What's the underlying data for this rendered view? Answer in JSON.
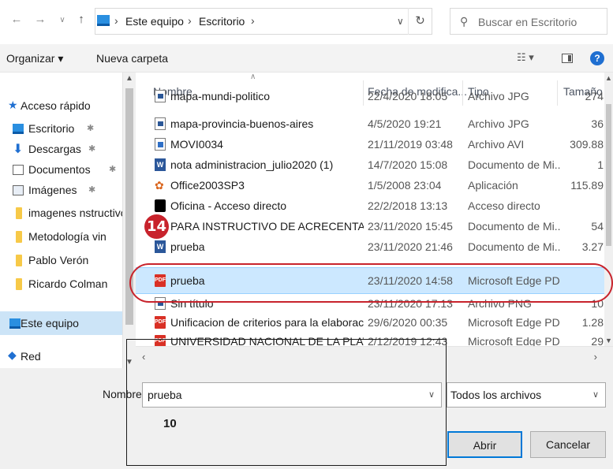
{
  "address": {
    "crumbs": [
      "Este equipo",
      "Escritorio"
    ],
    "search_placeholder": "Buscar en Escritorio"
  },
  "toolbar": {
    "organize": "Organizar ▾",
    "new_folder": "Nueva carpeta"
  },
  "sidebar": {
    "items": [
      {
        "label": "Acceso rápido",
        "icon": "star-icon",
        "pinned": false
      },
      {
        "label": "Escritorio",
        "icon": "desktop-icon",
        "pinned": true
      },
      {
        "label": "Descargas",
        "icon": "download-icon",
        "pinned": true
      },
      {
        "label": "Documentos",
        "icon": "documents-icon",
        "pinned": true
      },
      {
        "label": "Imágenes",
        "icon": "images-icon",
        "pinned": true
      },
      {
        "label": "imagenes nstructivo",
        "icon": "folder-icon",
        "pinned": false
      },
      {
        "label": "Metodología vin",
        "icon": "folder-icon",
        "pinned": false
      },
      {
        "label": "Pablo Verón",
        "icon": "folder-icon",
        "pinned": false
      },
      {
        "label": "Ricardo Colman",
        "icon": "folder-icon",
        "pinned": false
      },
      {
        "label": "Este equipo",
        "icon": "computer-icon",
        "pinned": false,
        "selected": true
      },
      {
        "label": "Red",
        "icon": "network-icon",
        "pinned": false
      }
    ]
  },
  "columns": {
    "name": "Nombre",
    "date": "Fecha de modifica...",
    "type": "Tipo",
    "size": "Tamaño"
  },
  "files": [
    {
      "name": "mapa-mundi-politico",
      "date": "22/4/2020 18:05",
      "type": "Archivo JPG",
      "size": "274",
      "icon": "image-file-icon"
    },
    {
      "name": "mapa-provincia-buenos-aires",
      "date": "4/5/2020 19:21",
      "type": "Archivo JPG",
      "size": "36",
      "icon": "image-file-icon"
    },
    {
      "name": "MOVI0034",
      "date": "21/11/2019 03:48",
      "type": "Archivo AVI",
      "size": "309.88",
      "icon": "video-file-icon"
    },
    {
      "name": "nota administracion_julio2020 (1)",
      "date": "14/7/2020 15:08",
      "type": "Documento de Mi...",
      "size": "1",
      "icon": "word-file-icon"
    },
    {
      "name": "Office2003SP3",
      "date": "1/5/2008 23:04",
      "type": "Aplicación",
      "size": "115.89",
      "icon": "application-icon"
    },
    {
      "name": "Oficina - Acceso directo",
      "date": "22/2/2018 13:13",
      "type": "Acceso directo",
      "size": "",
      "icon": "shortcut-icon"
    },
    {
      "name": "PARA INSTRUCTIVO DE ACRECENTAMIE...",
      "date": "23/11/2020 15:45",
      "type": "Documento de Mi...",
      "size": "54",
      "icon": "word-file-icon"
    },
    {
      "name": "prueba",
      "date": "23/11/2020 21:46",
      "type": "Documento de Mi...",
      "size": "3.27",
      "icon": "word-file-icon"
    },
    {
      "name": "prueba",
      "date": "23/11/2020 14:58",
      "type": "Microsoft Edge PD...",
      "size": "",
      "icon": "pdf-file-icon",
      "selected": true
    },
    {
      "name": "Sin título",
      "date": "23/11/2020 17:13",
      "type": "Archivo PNG",
      "size": "10",
      "icon": "image-file-icon"
    },
    {
      "name": "Unificacion de criterios para la elaboraci...",
      "date": "29/6/2020 00:35",
      "type": "Microsoft Edge PD...",
      "size": "1.28",
      "icon": "pdf-file-icon"
    },
    {
      "name": "UNIVERSIDAD NACIONAL DE LA PLATA ...",
      "date": "2/12/2019 12:43",
      "type": "Microsoft Edge PD...",
      "size": "29",
      "icon": "pdf-file-icon"
    }
  ],
  "bottom": {
    "name_label": "Nombre:",
    "name_value": "prueba",
    "filter": "Todos los archivos",
    "open": "Abrir",
    "cancel": "Cancelar"
  },
  "annotations": {
    "step_a": "14",
    "step_b": "10",
    "accent": "#c8232c"
  },
  "colors": {
    "selection": "#cce8ff",
    "primary_button_border": "#0078d7"
  }
}
